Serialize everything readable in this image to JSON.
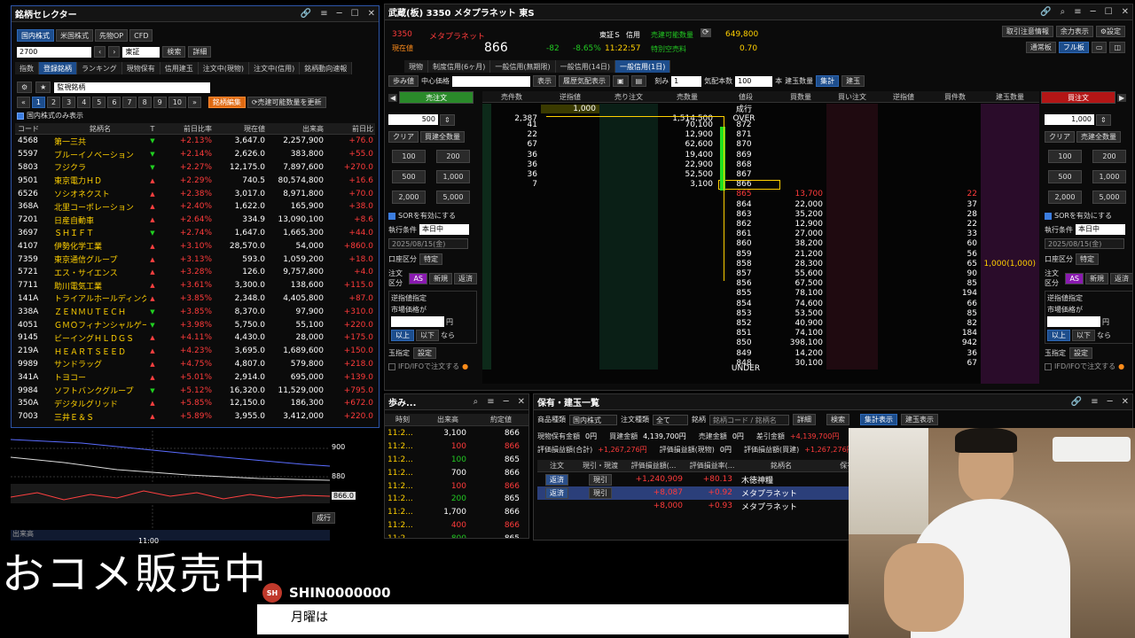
{
  "selector": {
    "title": "銘柄セレクター",
    "tabs": [
      "国内株式",
      "米国株式",
      "先物OP",
      "CFD"
    ],
    "code_value": "2700",
    "market": "東証",
    "search_label": "検索",
    "detail_label": "詳細",
    "subtabs": [
      "指数",
      "登録銘柄",
      "ランキング",
      "現物保有",
      "信用建玉",
      "注文中(現物)",
      "注文中(信用)",
      "銘柄動向速報"
    ],
    "list_name": "監視銘柄",
    "pages": [
      "1",
      "2",
      "3",
      "4",
      "5",
      "6",
      "7",
      "8",
      "9",
      "10"
    ],
    "edit_label": "銘柄編集",
    "update_label": "売建可能数量を更新",
    "domestic_only": "国内株式のみ表示",
    "headers": [
      "コード",
      "銘柄名",
      "T",
      "前日比率",
      "現在値",
      "出来高",
      "前日比"
    ],
    "rows": [
      [
        "4568",
        "第一三共",
        "dn",
        "+2.13%",
        "3,647.0",
        "2,257,900",
        "+76.0"
      ],
      [
        "5597",
        "ブルーイノベーション",
        "dn",
        "+2.14%",
        "2,626.0",
        "383,800",
        "+55.0"
      ],
      [
        "5803",
        "フジクラ",
        "dn",
        "+2.27%",
        "12,175.0",
        "7,897,600",
        "+270.0"
      ],
      [
        "9501",
        "東京電力ＨＤ",
        "up",
        "+2.29%",
        "740.5",
        "80,574,800",
        "+16.6"
      ],
      [
        "6526",
        "ソシオネクスト",
        "up",
        "+2.38%",
        "3,017.0",
        "8,971,800",
        "+70.0"
      ],
      [
        "368A",
        "北里コーポレーション",
        "up",
        "+2.40%",
        "1,622.0",
        "165,900",
        "+38.0"
      ],
      [
        "7201",
        "日産自動車",
        "up",
        "+2.64%",
        "334.9",
        "13,090,100",
        "+8.6"
      ],
      [
        "3697",
        "ＳＨＩＦＴ",
        "dn",
        "+2.74%",
        "1,647.0",
        "1,665,300",
        "+44.0"
      ],
      [
        "4107",
        "伊勢化学工業",
        "up",
        "+3.10%",
        "28,570.0",
        "54,000",
        "+860.0"
      ],
      [
        "7359",
        "東京通信グループ",
        "up",
        "+3.13%",
        "593.0",
        "1,059,200",
        "+18.0"
      ],
      [
        "5721",
        "エス・サイエンス",
        "up",
        "+3.28%",
        "126.0",
        "9,757,800",
        "+4.0"
      ],
      [
        "7711",
        "助川電気工業",
        "up",
        "+3.61%",
        "3,300.0",
        "138,600",
        "+115.0"
      ],
      [
        "141A",
        "トライアルホールディングス",
        "up",
        "+3.85%",
        "2,348.0",
        "4,405,800",
        "+87.0"
      ],
      [
        "338A",
        "ＺＥＮＭＵＴＥＣＨ",
        "dn",
        "+3.85%",
        "8,370.0",
        "97,900",
        "+310.0"
      ],
      [
        "4051",
        "ＧＭＯフィナンシャルゲート",
        "dn",
        "+3.98%",
        "5,750.0",
        "55,100",
        "+220.0"
      ],
      [
        "9145",
        "ビーイングＨＬＤＧＳ",
        "up",
        "+4.11%",
        "4,430.0",
        "28,000",
        "+175.0"
      ],
      [
        "219A",
        "ＨＥＡＲＴＳＥＥＤ",
        "up",
        "+4.23%",
        "3,695.0",
        "1,689,600",
        "+150.0"
      ],
      [
        "9989",
        "サンドラッグ",
        "up",
        "+4.75%",
        "4,807.0",
        "579,800",
        "+218.0"
      ],
      [
        "341A",
        "トヨコー",
        "up",
        "+5.01%",
        "2,914.0",
        "695,000",
        "+139.0"
      ],
      [
        "9984",
        "ソフトバンクグループ",
        "dn",
        "+5.12%",
        "16,320.0",
        "11,529,000",
        "+795.0"
      ],
      [
        "350A",
        "デジタルグリッド",
        "up",
        "+5.85%",
        "12,150.0",
        "186,300",
        "+672.0"
      ],
      [
        "7003",
        "三井Ｅ＆Ｓ",
        "up",
        "+5.89%",
        "3,955.0",
        "3,412,000",
        "+220.0"
      ]
    ]
  },
  "mini_chart": {
    "levels": [
      "900",
      "880"
    ],
    "price_tag": "866.0",
    "volume_label": "出来高",
    "time": "11:00",
    "btn": "成行"
  },
  "board": {
    "title": "武蔵(板) 3350 メタプラネット 東S",
    "code": "3350",
    "name": "メタプラネット",
    "market": "東証Ｓ",
    "credit": "信用",
    "current_label": "現在値",
    "price": "866",
    "change": "-82",
    "pct": "-8.65%",
    "time": "11:22:57",
    "short_label": "売建可能数量",
    "short_qty": "649,800",
    "special_label": "特別空売料",
    "special": "0.70",
    "right_btns": [
      "取引注意情報",
      "余力表示",
      "設定"
    ],
    "view_btns": [
      "通常板",
      "フル板"
    ],
    "tabs": [
      "現物",
      "制度信用(6ヶ月)",
      "一般信用(無期限)",
      "一般信用(14日)",
      "一般信用(1日)"
    ],
    "toolbar": {
      "ayumi": "歩み値",
      "center": "中心価格",
      "show": "表示",
      "history": "履歴気配表示",
      "tick": "刻み",
      "tick_val": "1",
      "ratio": "気配本数",
      "ratio_val": "100",
      "unit": "本",
      "tatedama": "建玉数量",
      "shukei": "集計",
      "tate": "建玉"
    },
    "sell_title": "売注文",
    "buy_title": "買注文",
    "headers": [
      "売件数",
      "逆指値",
      "売り注文",
      "売数量",
      "値段",
      "買数量",
      "買い注文",
      "逆指値",
      "買件数",
      "建玉数量"
    ],
    "market_row": {
      "price": "成行",
      "sell_qty": "1,000"
    },
    "over": {
      "count": "2,387",
      "qty": "1,514,500",
      "label": "OVER"
    },
    "asks": [
      [
        "41",
        "70,100",
        "872"
      ],
      [
        "22",
        "12,900",
        "871"
      ],
      [
        "67",
        "62,600",
        "870"
      ],
      [
        "36",
        "19,400",
        "869"
      ],
      [
        "36",
        "22,900",
        "868"
      ],
      [
        "36",
        "52,500",
        "867"
      ],
      [
        "7",
        "3,100",
        "866"
      ]
    ],
    "bids": [
      [
        "865",
        "13,700",
        "22",
        ""
      ],
      [
        "864",
        "22,000",
        "37",
        ""
      ],
      [
        "863",
        "35,200",
        "28",
        ""
      ],
      [
        "862",
        "12,900",
        "22",
        ""
      ],
      [
        "861",
        "27,000",
        "33",
        ""
      ],
      [
        "860",
        "38,200",
        "60",
        ""
      ],
      [
        "859",
        "21,200",
        "56",
        ""
      ],
      [
        "858",
        "28,300",
        "65",
        "1,000(1,000)"
      ],
      [
        "857",
        "55,600",
        "90",
        ""
      ],
      [
        "856",
        "67,500",
        "85",
        ""
      ],
      [
        "855",
        "78,100",
        "194",
        ""
      ],
      [
        "854",
        "74,600",
        "66",
        ""
      ],
      [
        "853",
        "53,500",
        "85",
        ""
      ],
      [
        "852",
        "40,900",
        "82",
        ""
      ],
      [
        "851",
        "74,100",
        "184",
        ""
      ],
      [
        "850",
        "398,100",
        "942",
        ""
      ],
      [
        "849",
        "14,200",
        "36",
        ""
      ],
      [
        "848",
        "30,100",
        "67",
        ""
      ]
    ],
    "under": "UNDER",
    "order": {
      "sell_qty": "500",
      "buy_qty": "1,000",
      "clear": "クリア",
      "sell_all": "買建全数量",
      "buy_all": "売建全数量",
      "qtys": [
        "100",
        "200",
        "500",
        "1,000",
        "2,000",
        "5,000"
      ],
      "sor": "SORを有効にする",
      "cond_label": "執行条件",
      "cond_val": "本日中",
      "account": "口座区分",
      "tokutei": "特定",
      "kind": "注文区分",
      "as": "AS",
      "shinki": "新規",
      "hensai": "返済",
      "stop": "逆指値指定",
      "market_price": "市場価格が",
      "yen": "円",
      "ijo": "以上",
      "ika": "以下",
      "nara": "なら",
      "settle": "玉指定",
      "settle_set": "設定",
      "ifd": "IFD/IFOで注文する",
      "date": "2025/08/15(金)"
    }
  },
  "ticks": {
    "title": "歩み...",
    "headers": [
      "時刻",
      "出来高",
      "約定値"
    ],
    "rows": [
      [
        "11:2...",
        "3,100",
        "866",
        "w"
      ],
      [
        "11:2...",
        "100",
        "866",
        "r"
      ],
      [
        "11:2...",
        "100",
        "865",
        "g"
      ],
      [
        "11:2...",
        "700",
        "866",
        "w"
      ],
      [
        "11:2...",
        "100",
        "866",
        "r"
      ],
      [
        "11:2...",
        "200",
        "865",
        "g"
      ],
      [
        "11:2...",
        "1,700",
        "866",
        "w"
      ],
      [
        "11:2...",
        "400",
        "866",
        "r"
      ],
      [
        "11:2...",
        "800",
        "865",
        "g"
      ]
    ]
  },
  "positions": {
    "title": "保有・建玉一覧",
    "product_label": "商品種類",
    "product": "国内株式",
    "order_kind": "注文種類",
    "order_val": "全て",
    "brand": "銘柄",
    "brand_ph": "銘柄コード / 銘柄名",
    "detail": "詳細",
    "search": "検索",
    "sum": "集計表示",
    "tate": "建玉表示",
    "summary1": [
      [
        "現物保有金額",
        "0円"
      ],
      [
        "買建金額",
        "4,139,700円"
      ],
      [
        "売建金額",
        "0円"
      ],
      [
        "差引金額",
        "+4,139,700円"
      ]
    ],
    "summary2": [
      [
        "評価損益額(合計)",
        "+1,267,276円"
      ],
      [
        "評価損益額(現物)",
        "0円"
      ],
      [
        "評価損益額(買建)",
        "+1,267,276円"
      ]
    ],
    "headers": [
      "注文",
      "現引・現渡",
      "評価損益額(...",
      "評価損益率(...",
      "銘柄名",
      "保有/"
    ],
    "rows": [
      [
        "返済",
        "現引",
        "+1,240,909",
        "+80.13",
        "木徳神糧"
      ],
      [
        "返済",
        "現引",
        "+8,087",
        "+0.92",
        "メタプラネット"
      ],
      [
        "",
        "",
        "+8,000",
        "+0.93",
        "メタプラネット"
      ]
    ]
  },
  "overlay": {
    "banner": "おコメ販売中",
    "user": "SHIN0000000",
    "avatar": "SH",
    "message": "月曜は"
  }
}
